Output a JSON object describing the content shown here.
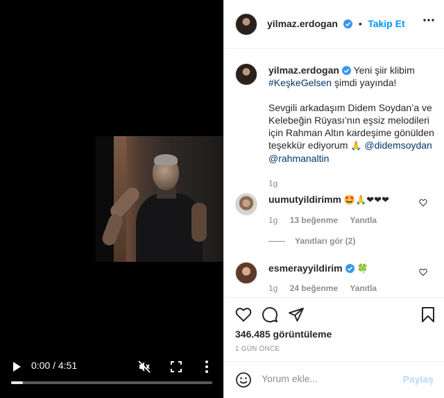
{
  "video": {
    "time": "0:00 / 4:51",
    "progress": 0.06,
    "icons": [
      "play-icon",
      "mute-icon",
      "fullscreen-icon",
      "more-icon"
    ]
  },
  "header": {
    "username": "yilmaz.erdogan",
    "separator": "•",
    "follow_label": "Takip Et"
  },
  "caption": {
    "username": "yilmaz.erdogan",
    "line1": "Yeni şiir klibim",
    "hashtag": "#KeşkeGelsen",
    "line1_rest": "şimdi yayında!",
    "para2": "Sevgili arkadaşım Didem Soydan’a ve Kelebeğin Rüyası’nın eşsiz melodileri için Rahman Altın kardeşime gönülden teşekkür ediyorum",
    "para2_emoji": "🙏",
    "mention1": "@didemsoydan",
    "mention2": "@rahmanaltin",
    "time": "1g"
  },
  "comments": [
    {
      "username": "uumutyildirimm",
      "text": "🤩🙏❤❤❤",
      "time": "1g",
      "likes": "13 beğenme",
      "reply": "Yanıtla"
    },
    {
      "username": "esmerayyildirim",
      "text": "🍀",
      "time": "1g",
      "likes": "24 beğenme",
      "reply": "Yanıtla"
    }
  ],
  "replies_label": "Yanıtları gör (2)",
  "stats": {
    "views": "346.485 görüntüleme",
    "ago": "1 GÜN ÖNCE"
  },
  "comment_box": {
    "placeholder": "Yorum ekle...",
    "share_label": "Paylaş"
  },
  "colors": {
    "accent": "#0095f6",
    "verified": "#3897f0",
    "heart": "#ed4956",
    "share_disabled": "#b3dbff"
  }
}
